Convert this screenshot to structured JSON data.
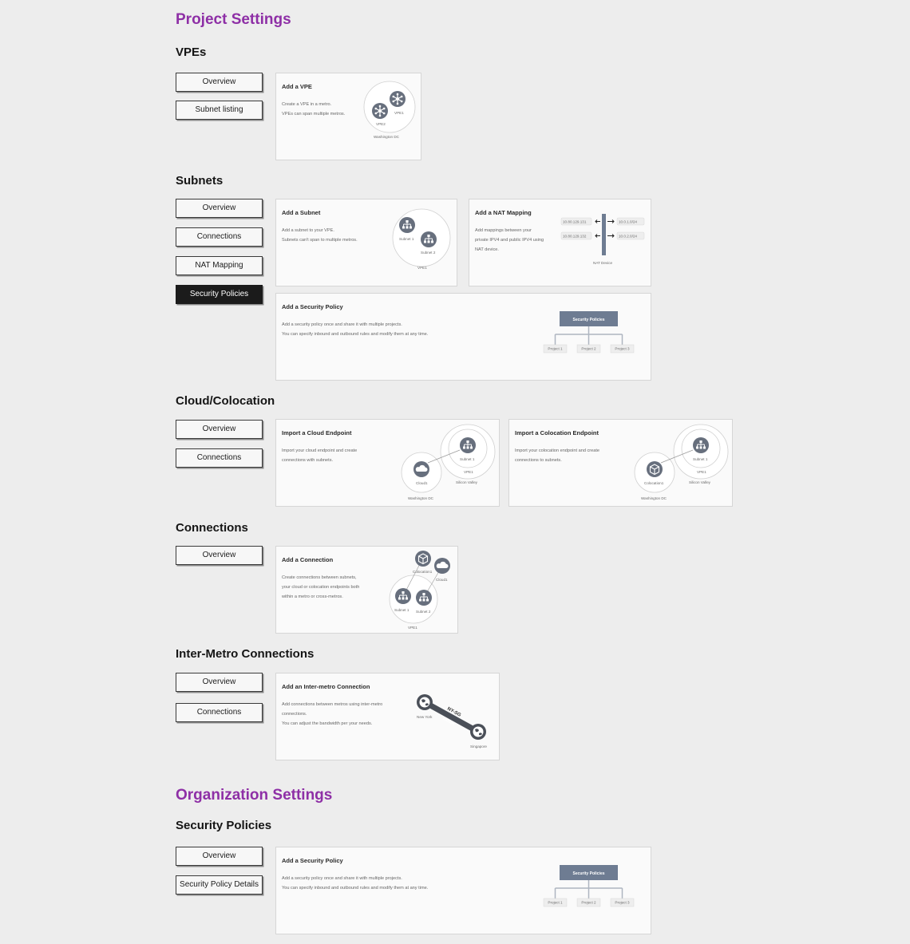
{
  "project_settings": {
    "heading": "Project Settings",
    "vpes": {
      "heading": "VPEs",
      "buttons": [
        "Overview",
        "Subnet listing"
      ],
      "card": {
        "title": "Add a VPE",
        "desc": [
          "Create a VPE in a metro.",
          "VPEs can span multiple metros."
        ],
        "labels": {
          "vpe1": "VPE1",
          "vpe2": "VPE2",
          "metro": "Washington DC"
        }
      }
    },
    "subnets": {
      "heading": "Subnets",
      "buttons": [
        "Overview",
        "Connections",
        "NAT Mapping",
        "Security Policies"
      ],
      "subnet_card": {
        "title": "Add a Subnet",
        "desc": [
          "Add a subnet to your VPE.",
          "Subnets can't span to multiple metros."
        ],
        "labels": {
          "subnet1": "Subnet 1",
          "subnet2": "Subnet 2",
          "vpe": "VPE1"
        }
      },
      "nat_card": {
        "title": "Add a NAT Mapping",
        "desc": [
          "Add mappings between your",
          "private IPV4 and public IPV4 using",
          "NAT device."
        ],
        "labels": {
          "ip1": "10.80.129.131",
          "ip2": "10.80.129.132",
          "ip3": "10.0.1.0/24",
          "ip4": "10.0.2.0/24",
          "device": "NAT Device"
        }
      },
      "policy_card": {
        "title": "Add a Security Policy",
        "desc": [
          "Add a security policy once and share it with multiple projects.",
          "You can specify inbound and outbound rules and modify them at any time."
        ],
        "labels": {
          "root": "Security Policies",
          "p1": "Project 1",
          "p2": "Project 2",
          "p3": "Project 3"
        }
      }
    },
    "cloud": {
      "heading": "Cloud/Colocation",
      "buttons": [
        "Overview",
        "Connections"
      ],
      "cloud_card": {
        "title": "Import a Cloud Endpoint",
        "desc": [
          "Import your cloud endpoint and create",
          "connections with subnets."
        ],
        "labels": {
          "subnet": "Subnet 1",
          "vpe": "VPE1",
          "metro_a": "Silicon Valley",
          "endpoint": "Cloud1",
          "metro_b": "Washington DC"
        }
      },
      "coloc_card": {
        "title": "Import a Colocation Endpoint",
        "desc": [
          "Import your colocation endpoint and create",
          "connections to subnets."
        ],
        "labels": {
          "subnet": "Subnet 1",
          "vpe": "VPE1",
          "metro_a": "Silicon Valley",
          "endpoint": "Colocation1",
          "metro_b": "Washington DC"
        }
      }
    },
    "connections": {
      "heading": "Connections",
      "buttons": [
        "Overview"
      ],
      "card": {
        "title": "Add a Connection",
        "desc": [
          "Create connections between subnets,",
          "your cloud or colocation endpoints both",
          "within a metro or cross-metros."
        ],
        "labels": {
          "coloc": "Colocation1",
          "cloud": "Cloud1",
          "subnet1": "Subnet 1",
          "subnet2": "Subnet 2",
          "vpe": "VPE1"
        }
      }
    },
    "inter_metro": {
      "heading": "Inter-Metro Connections",
      "buttons": [
        "Overview",
        "Connections"
      ],
      "card": {
        "title": "Add an Inter-metro Connection",
        "desc": [
          "Add connections between metros using inter-metro",
          "connections.",
          "You can adjust the bandwidth per your needs."
        ],
        "labels": {
          "a": "New York",
          "b": "Singapore",
          "line_top": "NY-SG",
          "line_bottom": "10Gbps"
        }
      }
    }
  },
  "org_settings": {
    "heading": "Organization Settings",
    "security": {
      "heading": "Security Policies",
      "buttons": [
        "Overview",
        "Security Policy Details"
      ],
      "card": {
        "title": "Add a Security Policy",
        "desc": [
          "Add a security policy once and share it with multiple projects.",
          "You can specify inbound and outbound rules and modify them at any time."
        ],
        "labels": {
          "root": "Security Policies",
          "p1": "Project 1",
          "p2": "Project 2",
          "p3": "Project 3"
        }
      }
    }
  },
  "colors": {
    "heading": "#8e2fa6",
    "icon": "#676f7d",
    "policy_box": "#6e7c92",
    "active_button": "#1b1b1b"
  },
  "icons": [
    "network-icon",
    "hub-icon",
    "cloud-icon",
    "cube-icon",
    "globe-icon",
    "arrow-icon"
  ]
}
